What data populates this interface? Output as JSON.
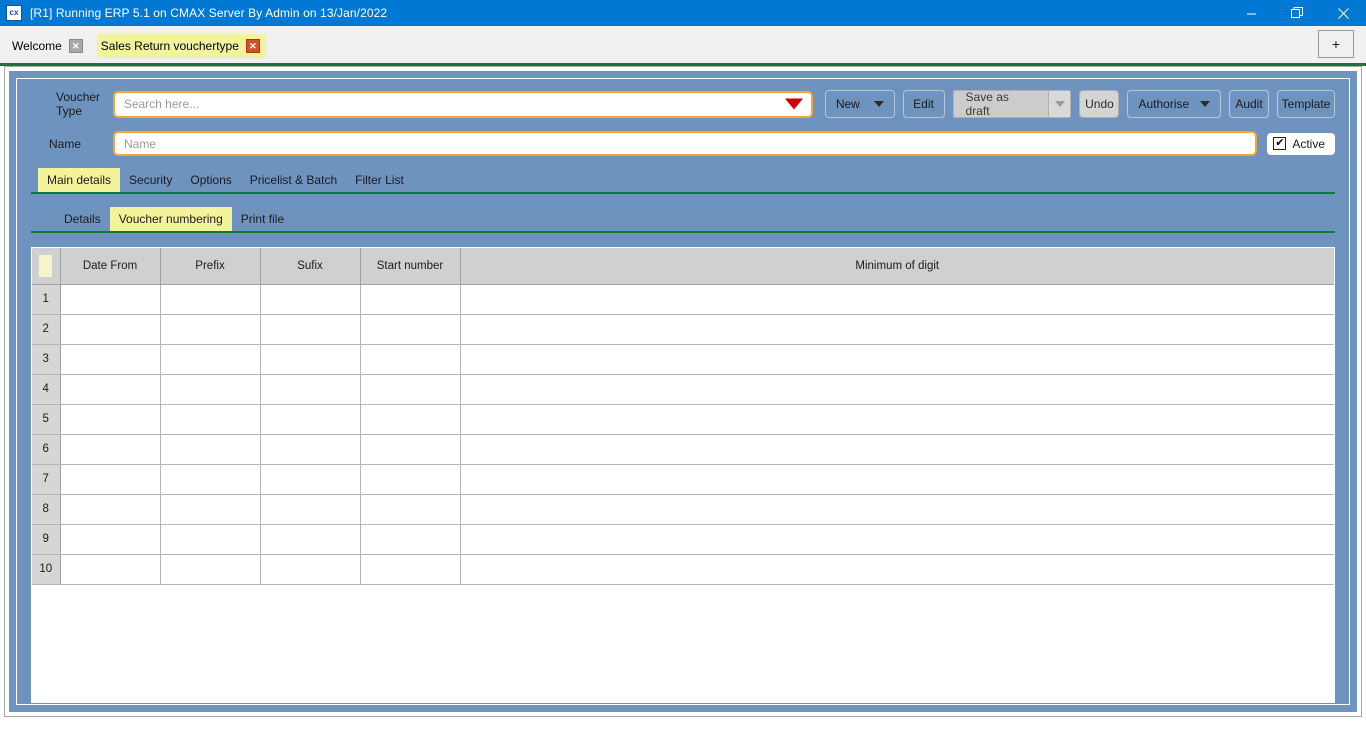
{
  "window": {
    "title": "[R1] Running ERP 5.1 on CMAX Server By Admin on 13/Jan/2022",
    "app_icon": "cx",
    "minimize_label": "Minimize",
    "restore_label": "Restore",
    "close_label": "Close"
  },
  "tabstrip": {
    "tabs": [
      {
        "label": "Welcome",
        "close": "✕",
        "active": false
      },
      {
        "label": "Sales Return vouchertype",
        "close": "✕",
        "active": true
      }
    ],
    "add_tab_label": "+"
  },
  "form": {
    "voucher_type_label": "Voucher Type",
    "voucher_type_placeholder": "Search here...",
    "voucher_type_value": "",
    "name_label": "Name",
    "name_placeholder": "Name",
    "name_value": "",
    "active_label": "Active",
    "active_checked": true,
    "active_check_glyph": "✔"
  },
  "toolbar": {
    "new_label": "New",
    "edit_label": "Edit",
    "save_as_draft_label": "Save as draft",
    "undo_label": "Undo",
    "authorise_label": "Authorise",
    "audit_label": "Audit",
    "template_label": "Template"
  },
  "tabs_primary": [
    {
      "label": "Main details",
      "selected": true
    },
    {
      "label": "Security",
      "selected": false
    },
    {
      "label": "Options",
      "selected": false
    },
    {
      "label": "Pricelist & Batch",
      "selected": false
    },
    {
      "label": "Filter List",
      "selected": false
    }
  ],
  "tabs_secondary": [
    {
      "label": "Details",
      "selected": false
    },
    {
      "label": "Voucher numbering",
      "selected": true
    },
    {
      "label": "Print file",
      "selected": false
    }
  ],
  "grid": {
    "columns": [
      "Date From",
      "Prefix",
      "Sufix",
      "Start number",
      "Minimum of digit"
    ],
    "rows": [
      {
        "num": "1",
        "cells": [
          "",
          "",
          "",
          "",
          ""
        ]
      },
      {
        "num": "2",
        "cells": [
          "",
          "",
          "",
          "",
          ""
        ]
      },
      {
        "num": "3",
        "cells": [
          "",
          "",
          "",
          "",
          ""
        ]
      },
      {
        "num": "4",
        "cells": [
          "",
          "",
          "",
          "",
          ""
        ]
      },
      {
        "num": "5",
        "cells": [
          "",
          "",
          "",
          "",
          ""
        ]
      },
      {
        "num": "6",
        "cells": [
          "",
          "",
          "",
          "",
          ""
        ]
      },
      {
        "num": "7",
        "cells": [
          "",
          "",
          "",
          "",
          ""
        ]
      },
      {
        "num": "8",
        "cells": [
          "",
          "",
          "",
          "",
          ""
        ]
      },
      {
        "num": "9",
        "cells": [
          "",
          "",
          "",
          "",
          ""
        ]
      },
      {
        "num": "10",
        "cells": [
          "",
          "",
          "",
          "",
          ""
        ]
      }
    ]
  },
  "colors": {
    "titlebar": "#0078d4",
    "panel": "#6e93bf",
    "accent_green": "#0f7a33",
    "tab_highlight": "#f3f39c",
    "field_border": "#f0a830",
    "dropdown_red": "#d00000",
    "header_grey": "#d0d0d0"
  }
}
